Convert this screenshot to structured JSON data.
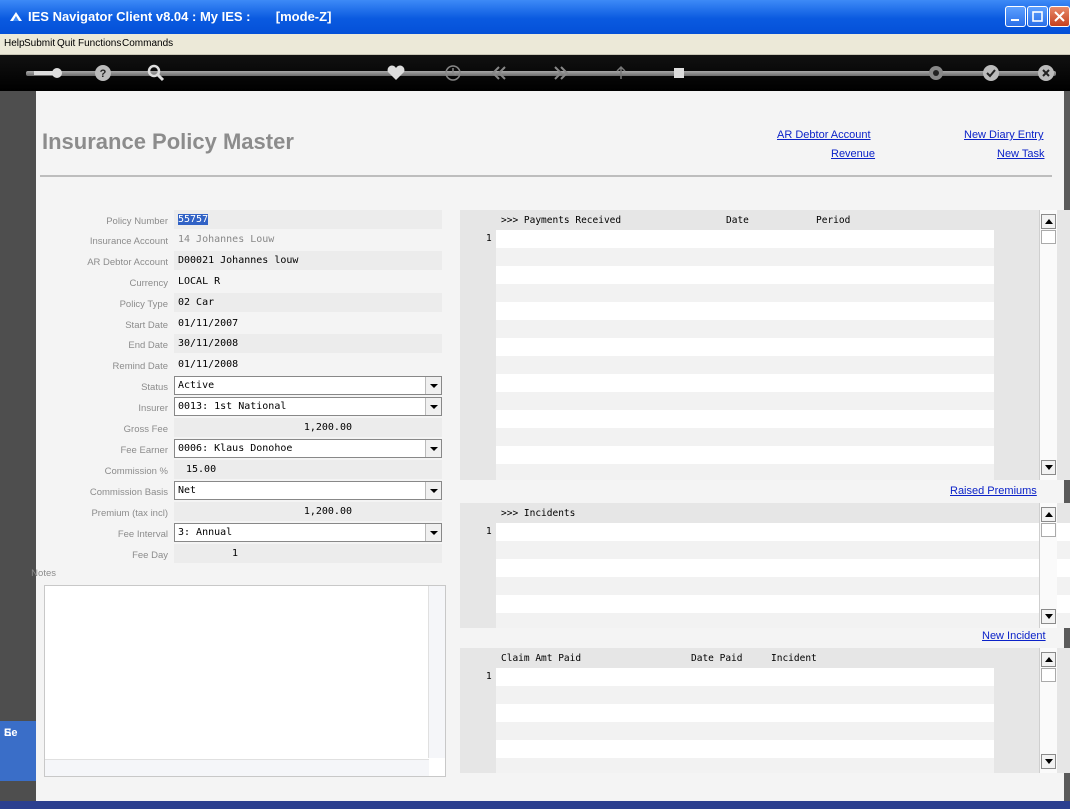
{
  "window": {
    "title": "IES Navigator Client v8.04 : My IES :       [mode-Z]"
  },
  "menu": [
    "Help",
    "Submit",
    "Quit",
    "Functions",
    "Commands"
  ],
  "toolbar_icons": [
    "key-icon",
    "help-icon",
    "search-icon",
    "heart-icon",
    "clock-icon",
    "rewind-icon",
    "forward-icon",
    "upload-icon",
    "stop-icon",
    "gear-icon",
    "check-icon",
    "close-icon"
  ],
  "page": {
    "title": "Insurance Policy Master"
  },
  "links": {
    "ar_debtor": "AR Debtor Account",
    "revenue": "Revenue",
    "new_diary": "New Diary Entry",
    "new_task": "New Task",
    "raised_premiums": "Raised Premiums",
    "new_incident": "New Incident"
  },
  "form": {
    "policy_number": {
      "label": "Policy Number",
      "value": "55757"
    },
    "insurance_account": {
      "label": "Insurance Account",
      "value": "14 Johannes Louw"
    },
    "ar_debtor_account": {
      "label": "AR Debtor Account",
      "value": "D00021 Johannes louw"
    },
    "currency": {
      "label": "Currency",
      "value": "LOCAL R"
    },
    "policy_type": {
      "label": "Policy Type",
      "value": "02 Car"
    },
    "start_date": {
      "label": "Start Date",
      "value": "01/11/2007"
    },
    "end_date": {
      "label": "End Date",
      "value": "30/11/2008"
    },
    "remind_date": {
      "label": "Remind Date",
      "value": "01/11/2008"
    },
    "status": {
      "label": "Status",
      "value": "Active"
    },
    "insurer": {
      "label": "Insurer",
      "value": "0013: 1st National"
    },
    "gross_fee": {
      "label": "Gross Fee",
      "value": "1,200.00"
    },
    "fee_earner": {
      "label": "Fee Earner",
      "value": "0006: Klaus Donohoe"
    },
    "commission_pct": {
      "label": "Commission %",
      "value": "15.00"
    },
    "commission_basis": {
      "label": "Commission Basis",
      "value": "Net"
    },
    "premium": {
      "label": "Premium (tax incl)",
      "value": "1,200.00"
    },
    "fee_interval": {
      "label": "Fee Interval",
      "value": "3: Annual"
    },
    "fee_day": {
      "label": "Fee Day",
      "value": "1"
    },
    "notes_label": "Notes"
  },
  "grids": {
    "payments": {
      "headers": [
        ">>> Payments Received",
        "Date",
        "Period"
      ],
      "row": "1"
    },
    "incidents": {
      "headers": [
        ">>> Incidents"
      ],
      "row": "1"
    },
    "claims": {
      "headers": [
        "Claim Amt Paid",
        "Date Paid",
        "Incident"
      ],
      "row": "1"
    }
  },
  "taskbar": {
    "label": "Se"
  }
}
